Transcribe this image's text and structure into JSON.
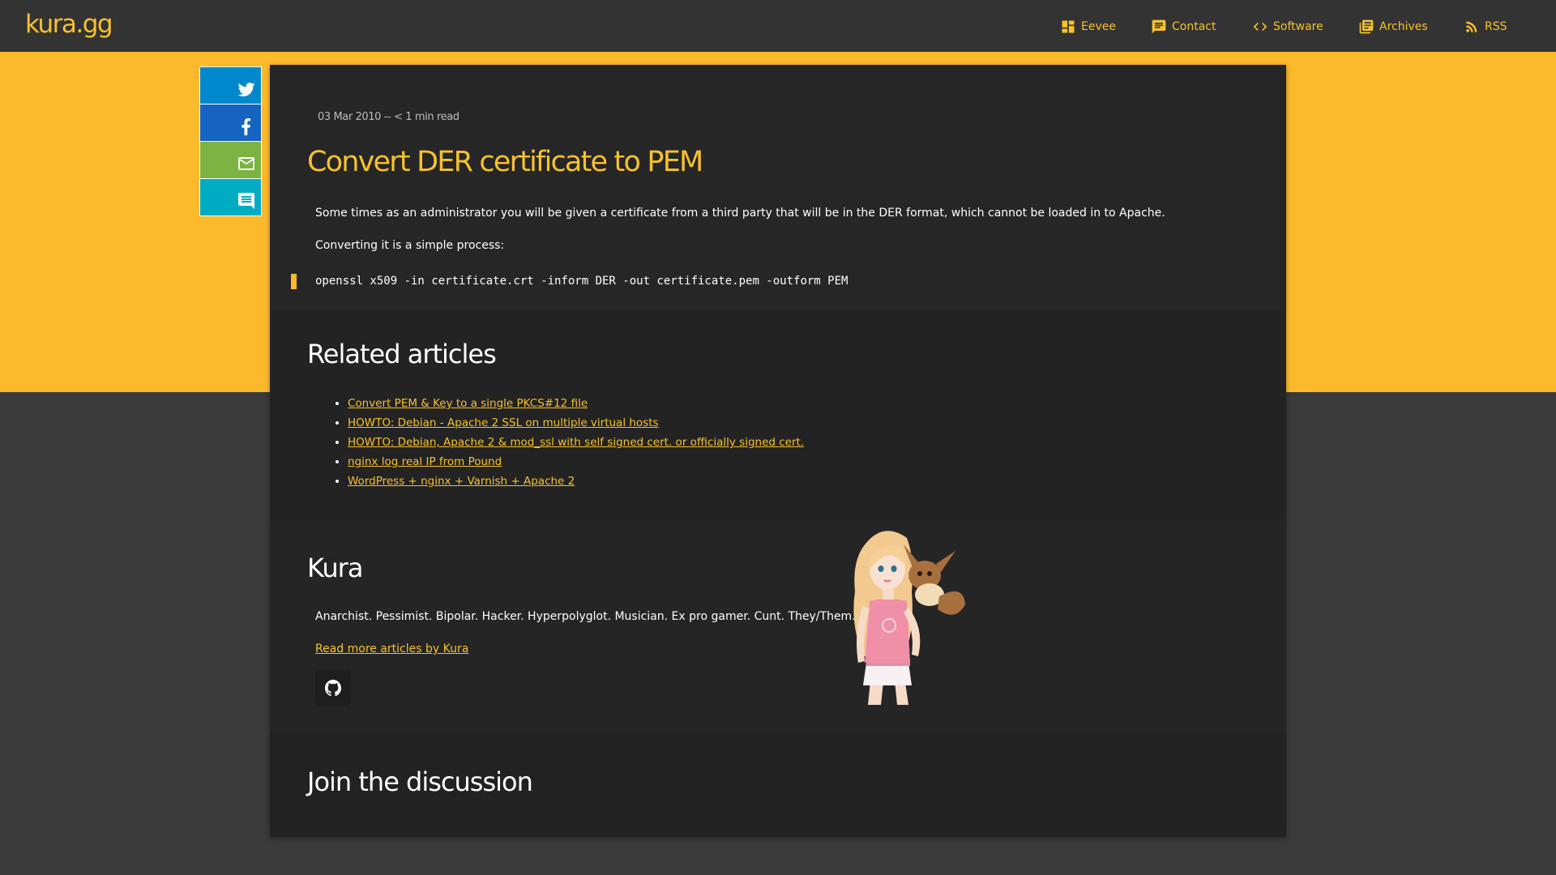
{
  "nav": {
    "logo": "kura.gg",
    "items": [
      {
        "label": "Eevee",
        "icon": "dashboard-icon"
      },
      {
        "label": "Contact",
        "icon": "chat-icon"
      },
      {
        "label": "Software",
        "icon": "code-icon"
      },
      {
        "label": "Archives",
        "icon": "library-books-icon"
      },
      {
        "label": "RSS",
        "icon": "rss-feed-icon"
      }
    ]
  },
  "share": [
    {
      "name": "twitter",
      "icon": "twitter-icon",
      "color": "#0088cc"
    },
    {
      "name": "facebook",
      "icon": "facebook-icon",
      "color": "#1565c0"
    },
    {
      "name": "email",
      "icon": "mail-icon",
      "color": "#7cb342"
    },
    {
      "name": "comments",
      "icon": "comment-icon",
      "color": "#00acc1"
    }
  ],
  "colors": {
    "accent": "#f8c12f",
    "band": "#fbba2c",
    "page_bg": "#3a3a3a",
    "card_bg": "#252525",
    "navbar_bg": "#333333"
  },
  "post": {
    "meta": "03 Mar 2010 -- < 1 min read",
    "title": "Convert DER certificate to PEM",
    "para1": "Some times as an administrator you will be given a certificate from a third party that will be in the DER format, which cannot be loaded in to Apache.",
    "para2": "Converting it is a simple process:",
    "code": "openssl x509 -in certificate.crt -inform DER -out certificate.pem -outform PEM"
  },
  "related": {
    "heading": "Related articles",
    "items": [
      "Convert PEM & Key to a single PKCS#12 file",
      "HOWTO: Debian - Apache 2 SSL on multiple virtual hosts",
      "HOWTO: Debian, Apache 2 & mod_ssl with self signed cert. or officially signed cert.",
      "nginx log real IP from Pound",
      "WordPress + nginx + Varnish + Apache 2"
    ]
  },
  "author": {
    "name": "Kura",
    "bio": "Anarchist. Pessimist. Bipolar. Hacker. Hyperpolyglot. Musician. Ex pro gamer. Cunt. They/Them.",
    "more_link": "Read more articles by Kura",
    "social_icon": "github-icon"
  },
  "discussion": {
    "heading": "Join the discussion"
  }
}
